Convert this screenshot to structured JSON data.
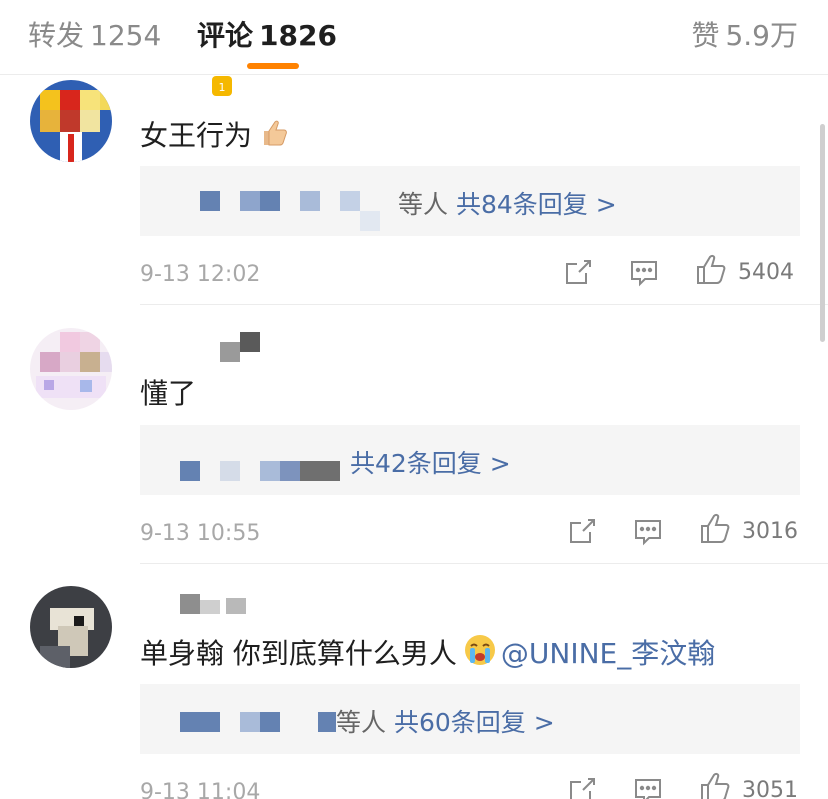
{
  "tabs": {
    "repost": {
      "label": "转发",
      "count": "1254"
    },
    "comments": {
      "label": "评论",
      "count": "1826"
    },
    "likes": {
      "label": "赞",
      "count": "5.9万"
    }
  },
  "comments": [
    {
      "text": "女王行为",
      "emoji": "thumbs-up",
      "reply_people_suffix": "等人",
      "reply_summary": "共84条回复 >",
      "timestamp": "9-13 12:02",
      "like_count": "5404"
    },
    {
      "text": "懂了",
      "reply_summary": "共42条回复 >",
      "timestamp": "9-13 10:55",
      "like_count": "3016"
    },
    {
      "text": "单身翰 你到底算什么男人",
      "emoji": "crying-face",
      "mention": "@UNINE_李汶翰",
      "reply_people_suffix": "等人",
      "reply_summary": "共60条回复 >",
      "timestamp": "9-13 11:04",
      "like_count": "3051"
    }
  ],
  "colors": {
    "accent": "#ff8200",
    "link": "#4a6da6",
    "reply_bg": "#f5f5f5",
    "meta_text": "#a8a8a8"
  },
  "icons": [
    "share-icon",
    "reply-icon",
    "like-icon"
  ]
}
